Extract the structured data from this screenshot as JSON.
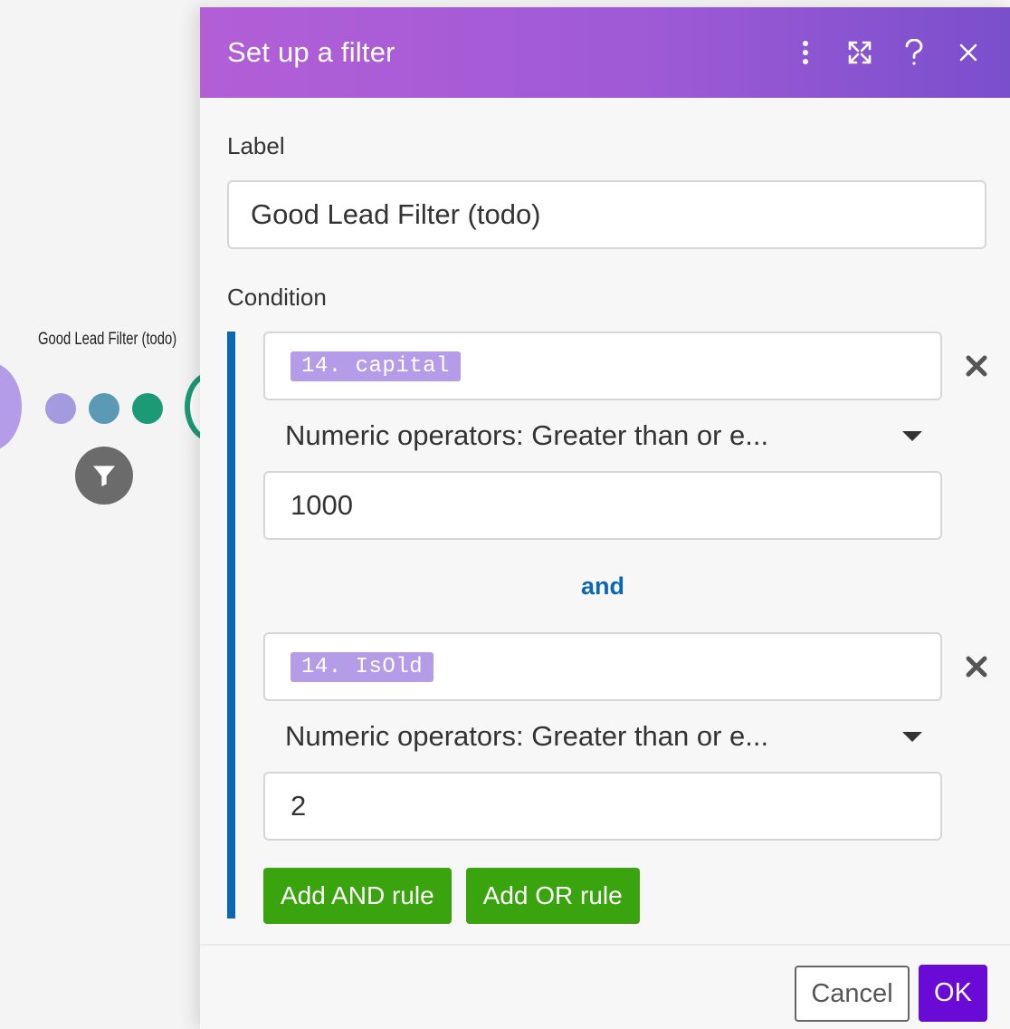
{
  "canvas": {
    "route_label": "Good Lead Filter (todo)"
  },
  "dialog": {
    "title": "Set up a filter",
    "header_icons": [
      "more-vertical-icon",
      "expand-icon",
      "help-icon",
      "close-icon"
    ],
    "label_field": {
      "label": "Label",
      "value": "Good Lead Filter (todo)"
    },
    "condition": {
      "label": "Condition",
      "rules": [
        {
          "operand": "14. capital",
          "operator": "Numeric operators: Greater than or e...",
          "value": "1000"
        },
        {
          "operand": "14. IsOld",
          "operator": "Numeric operators: Greater than or e...",
          "value": "2"
        }
      ],
      "joiner": "and",
      "add_and_label": "Add AND rule",
      "add_or_label": "Add OR rule"
    },
    "footer": {
      "cancel_label": "Cancel",
      "ok_label": "OK"
    }
  },
  "colors": {
    "header_gradient_start": "#b25fd6",
    "header_gradient_end": "#7a4fcc",
    "condition_bar": "#0b67b2",
    "pill": "#b49ce8",
    "green_button": "#3aa40f",
    "ok_button": "#6a0ad6"
  }
}
